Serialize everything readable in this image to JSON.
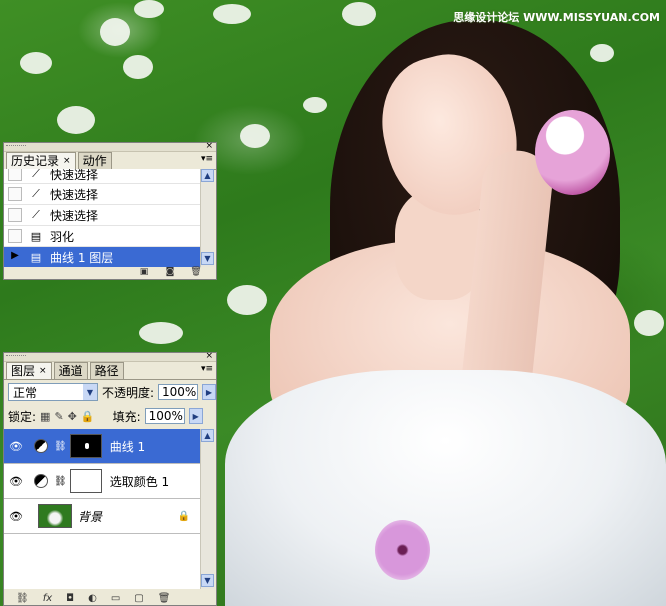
{
  "watermark": "思缘设计论坛  WWW.MISSYUAN.COM",
  "history_panel": {
    "tabs": [
      {
        "label": "历史记录",
        "active": true
      },
      {
        "label": "动作",
        "active": false
      }
    ],
    "close_icon": "×",
    "items": [
      {
        "label": "快速选择",
        "icon": "quick-select-icon",
        "selected": false
      },
      {
        "label": "快速选择",
        "icon": "quick-select-icon",
        "selected": false
      },
      {
        "label": "快速选择",
        "icon": "quick-select-icon",
        "selected": false
      },
      {
        "label": "羽化",
        "icon": "history-state-icon",
        "selected": false
      },
      {
        "label": "曲线 1 图层",
        "icon": "history-state-icon",
        "selected": true
      }
    ],
    "footer_icons": [
      "new-document-from-state-icon",
      "new-snapshot-icon",
      "trash-icon"
    ]
  },
  "layers_panel": {
    "tabs": [
      {
        "label": "图层",
        "active": true
      },
      {
        "label": "通道",
        "active": false
      },
      {
        "label": "路径",
        "active": false
      }
    ],
    "blend_mode": "正常",
    "opacity_label": "不透明度:",
    "opacity_value": "100%",
    "lock_label": "锁定:",
    "fill_label": "填充:",
    "fill_value": "100%",
    "layers": [
      {
        "name": "曲线 1",
        "type": "adjustment",
        "mask": "black",
        "selected": true
      },
      {
        "name": "选取颜色 1",
        "type": "adjustment",
        "mask": "white",
        "selected": false
      },
      {
        "name": "背景",
        "type": "background",
        "locked": true,
        "selected": false
      }
    ],
    "footer_icons": [
      "link-layers-icon",
      "layer-style-icon",
      "add-mask-icon",
      "adjustment-layer-icon",
      "new-group-icon",
      "new-layer-icon",
      "trash-icon"
    ]
  }
}
